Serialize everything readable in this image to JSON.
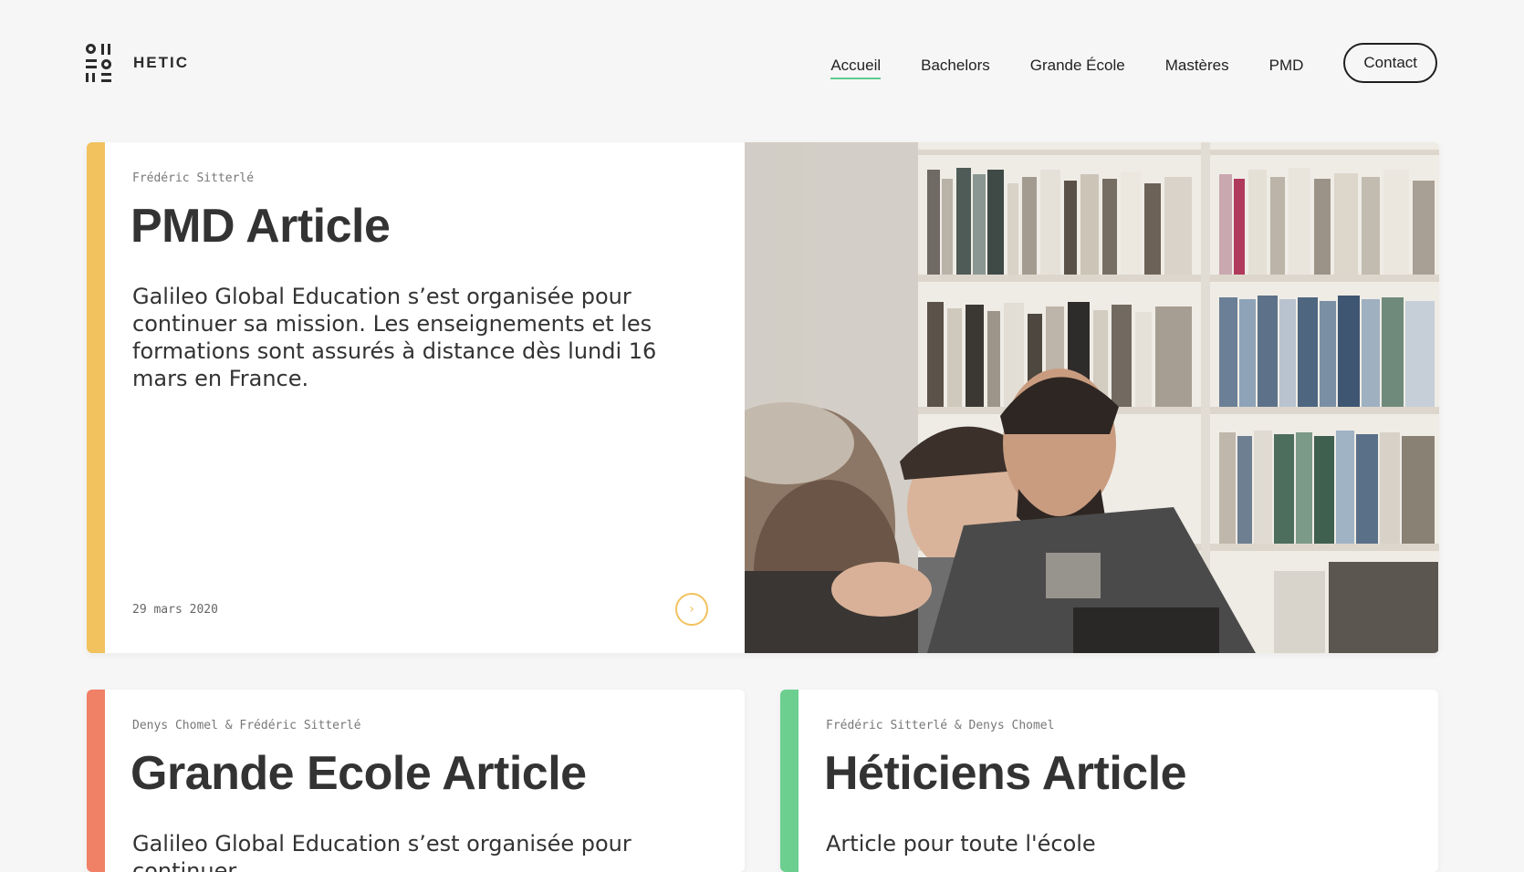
{
  "brand": {
    "name": "HETIC"
  },
  "nav": {
    "items": [
      {
        "label": "Accueil",
        "active": true
      },
      {
        "label": "Bachelors",
        "active": false
      },
      {
        "label": "Grande École",
        "active": false
      },
      {
        "label": "Mastères",
        "active": false
      },
      {
        "label": "PMD",
        "active": false
      }
    ],
    "contact_label": "Contact"
  },
  "colors": {
    "yellow": "#f2c25e",
    "coral": "#f08066",
    "green": "#6ccf8f",
    "nav_underline": "#5ecb8f"
  },
  "featured": {
    "author": "Frédéric Sitterlé",
    "title": "PMD Article",
    "description": "Galileo Global Education s’est organisée pour continuer sa mission. Les enseignements et les formations sont assurés à distance dès lundi 16 mars en France.",
    "date": "29 mars 2020",
    "arrow_icon": "chevron-right-icon",
    "image_alt": "Students laughing in front of bookshelves"
  },
  "cards": [
    {
      "author": "Denys Chomel & Frédéric Sitterlé",
      "title": "Grande Ecole Article",
      "description": "Galileo Global Education s’est organisée pour continuer"
    },
    {
      "author": "Frédéric Sitterlé & Denys Chomel",
      "title": "Héticiens Article",
      "description": "Article pour toute l'école"
    }
  ]
}
